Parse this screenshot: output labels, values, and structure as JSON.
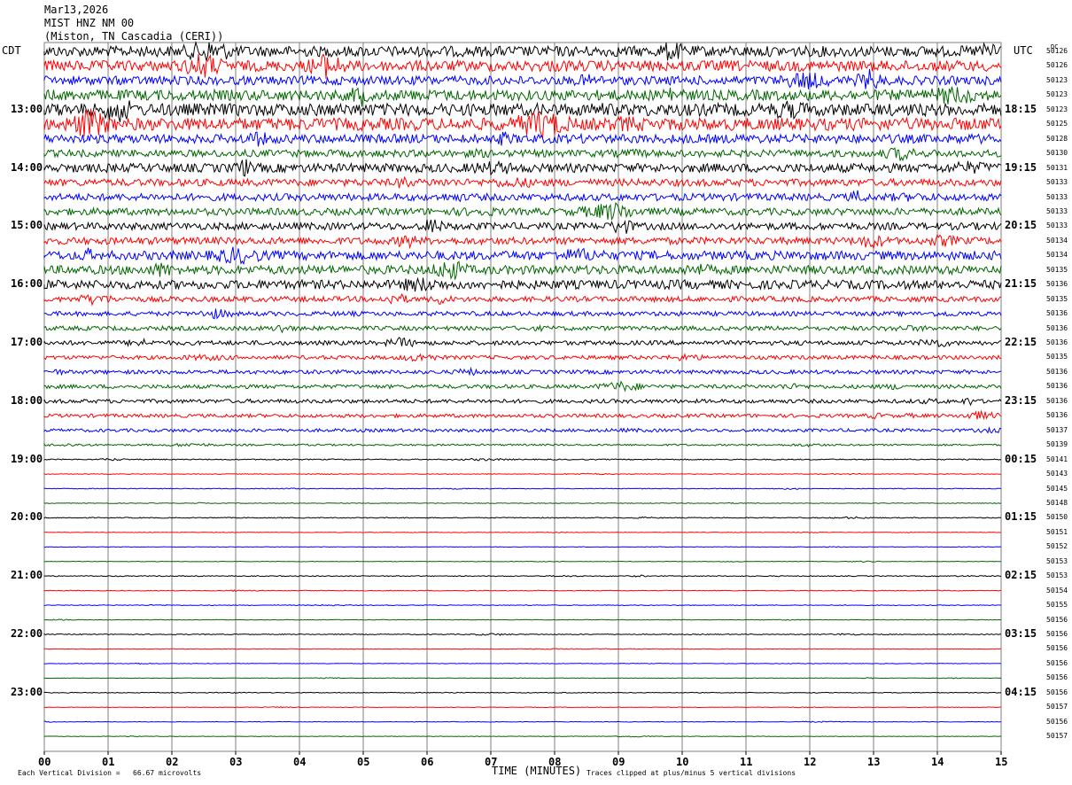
{
  "header": {
    "date": "Mar13,2026",
    "station": "MIST HNZ NM 00",
    "location": "(Miston, TN Cascadia (CERI))"
  },
  "left_tz": "CDT",
  "right_tz": "UTC",
  "dc_header": "DC",
  "footer": {
    "xlabel": "TIME (MINUTES)",
    "scale_note": "Each Vertical Division =   66.67 microvolts",
    "clip_note": "Traces clipped at plus/minus 5 vertical divisions"
  },
  "colors": {
    "black": "#000000",
    "red": "#ff0000",
    "blue": "#0000ff",
    "green": "#006600",
    "grid": "#7f7f7f"
  },
  "chart_data": {
    "type": "line",
    "x_minutes": [
      0,
      15
    ],
    "xticks": [
      "00",
      "01",
      "02",
      "03",
      "04",
      "05",
      "06",
      "07",
      "08",
      "09",
      "10",
      "11",
      "12",
      "13",
      "14",
      "15"
    ],
    "trace_colors": [
      "black",
      "red",
      "blue",
      "green"
    ],
    "hours_left": [
      "13:00",
      "14:00",
      "15:00",
      "16:00",
      "17:00",
      "18:00",
      "19:00",
      "20:00",
      "21:00",
      "22:00",
      "23:00"
    ],
    "hours_right": [
      "18:15",
      "19:15",
      "20:15",
      "21:15",
      "22:15",
      "23:15",
      "00:15",
      "01:15",
      "02:15",
      "03:15",
      "04:15"
    ],
    "dc_offsets": [
      "50126",
      "50126",
      "50123",
      "50123",
      "50123",
      "50125",
      "50128",
      "50130",
      "50131",
      "50133",
      "50133",
      "50133",
      "50133",
      "50134",
      "50134",
      "50135",
      "50136",
      "50135",
      "50136",
      "50136",
      "50136",
      "50135",
      "50136",
      "50136",
      "50136",
      "50136",
      "50137",
      "50139",
      "50141",
      "50143",
      "50145",
      "50148",
      "50150",
      "50151",
      "50152",
      "50153",
      "50153",
      "50154",
      "50155",
      "50156",
      "50156",
      "50156",
      "50156",
      "50156",
      "50156",
      "50157",
      "50156",
      "50157"
    ],
    "activity": [
      6,
      6,
      5,
      6,
      7,
      7,
      5,
      4,
      5,
      4,
      4,
      4,
      4,
      4,
      5,
      5,
      5,
      3,
      2.5,
      2.5,
      2.5,
      2.2,
      2.2,
      2.2,
      2.2,
      2,
      1.8,
      1,
      0.6,
      0.4,
      0.4,
      0.4,
      0.5,
      0.3,
      0.3,
      0.3,
      0.5,
      0.4,
      0.4,
      0.3,
      0.5,
      0.3,
      0.3,
      0.3,
      0.4,
      0.3,
      0.3,
      0.3
    ]
  }
}
